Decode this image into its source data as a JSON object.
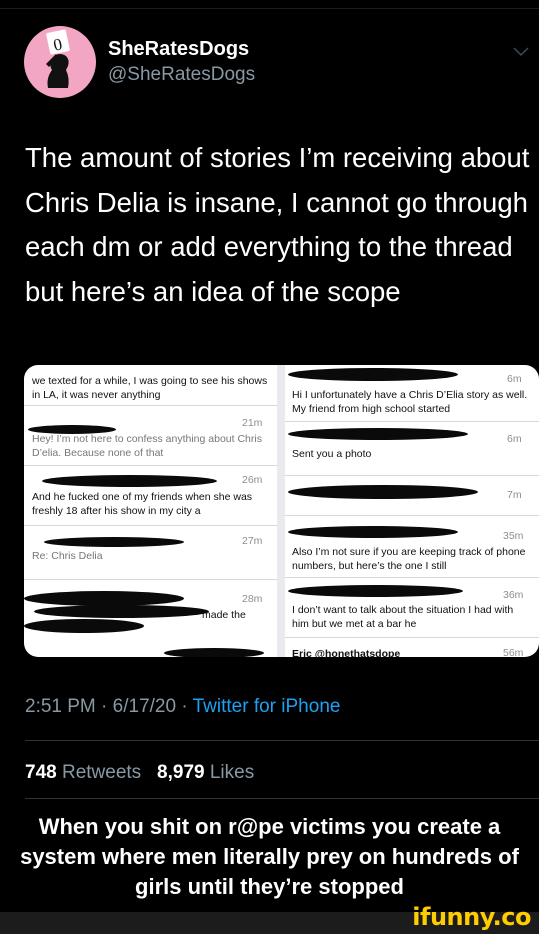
{
  "account": {
    "name": "SheRatesDogs",
    "handle": "@SheRatesDogs"
  },
  "tweet": {
    "text": "The amount of stories I’m receiving about Chris Delia is insane, I cannot go through each dm or add everything to the thread but here’s an idea of the scope",
    "time": "2:51 PM",
    "date": "6/17/20",
    "source": "Twitter for iPhone",
    "retweets_count": "748",
    "retweets_label": "Retweets",
    "likes_count": "8,979",
    "likes_label": "Likes"
  },
  "screenshot": {
    "left": [
      {
        "text": "we texted for a while, I was going to see his shows in LA, it was never anything",
        "time": ""
      },
      {
        "text": "Hey! I’m not here to confess anything about Chris D’elia. Because none of that",
        "time": "21m"
      },
      {
        "text": "And he fucked one of my friends when she was freshly 18 after his show in my city a",
        "time": "26m"
      },
      {
        "text": "Re: Chris Delia",
        "time": "27m"
      },
      {
        "text": "made the",
        "time": "28m"
      }
    ],
    "right": [
      {
        "text": "Hi I unfortunately have a Chris D’Elia story as well. My friend from high school started",
        "time": "6m"
      },
      {
        "text": "Sent you a photo",
        "time": "6m"
      },
      {
        "text": "",
        "time": "7m"
      },
      {
        "text": "Also I’m not sure if you are keeping track of phone numbers, but here’s the one I still",
        "time": "35m"
      },
      {
        "text": "I don’t want to talk about the situation I had with him but we met at a bar he",
        "time": "36m"
      },
      {
        "text": "Eric @honethatsdope",
        "time": "56m"
      }
    ]
  },
  "caption": "When you shit on r@pe victims you create a system where men literally prey on hundreds of girls until they’re stopped",
  "branding": {
    "watermark": "ifunny.co",
    "accent_color": "#ffcc00"
  },
  "colors": {
    "background": "#000000",
    "link": "#1da1f2",
    "muted": "#8899a6",
    "avatar_bg": "#f3a6c3"
  },
  "icons": {
    "more": "chevron-down-icon"
  }
}
